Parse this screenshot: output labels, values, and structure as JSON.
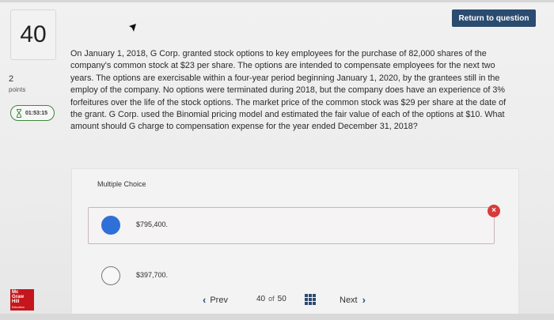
{
  "header": {
    "return_button": "Return to question"
  },
  "sidebar": {
    "question_number": "40",
    "points_value": "2",
    "points_label": "points",
    "timer": "01:53:15"
  },
  "question": {
    "text": "On January 1, 2018, G Corp. granted stock options to key employees for the purchase of 82,000 shares of the company's common stock at $23 per share. The options are intended to compensate employees for the next two years. The options are exercisable within a four-year period beginning January 1, 2020, by the grantees still in the employ of the company. No options were terminated during 2018, but the company does have an experience of 3% forfeitures over the life of the stock options. The market price of the common stock was $29 per share at the date of the grant. G Corp. used the Binomial pricing model and estimated the fair value of each of the options at $10. What amount should G charge to compensation expense for the year ended December 31, 2018?"
  },
  "answers": {
    "type_label": "Multiple Choice",
    "choices": [
      {
        "label": "$795,400.",
        "selected": true,
        "marked_incorrect": true
      },
      {
        "label": "$397,700.",
        "selected": false
      }
    ],
    "incorrect_mark": "×"
  },
  "footer": {
    "logo_lines": [
      "Mc",
      "Graw",
      "Hill",
      "Education"
    ],
    "prev_label": "Prev",
    "current_page": "40",
    "of_label": "of",
    "total_pages": "50",
    "next_label": "Next",
    "prev_chevron": "‹",
    "next_chevron": "›"
  },
  "colors": {
    "accent": "#2b4b6f",
    "selected_radio": "#2f6fd8",
    "incorrect": "#d73b3b",
    "timer_border": "#3a8a3a",
    "logo": "#c4161c"
  },
  "icons": {
    "timer": "hourglass-icon",
    "incorrect": "x-circle-icon",
    "question_map": "grid-icon"
  }
}
